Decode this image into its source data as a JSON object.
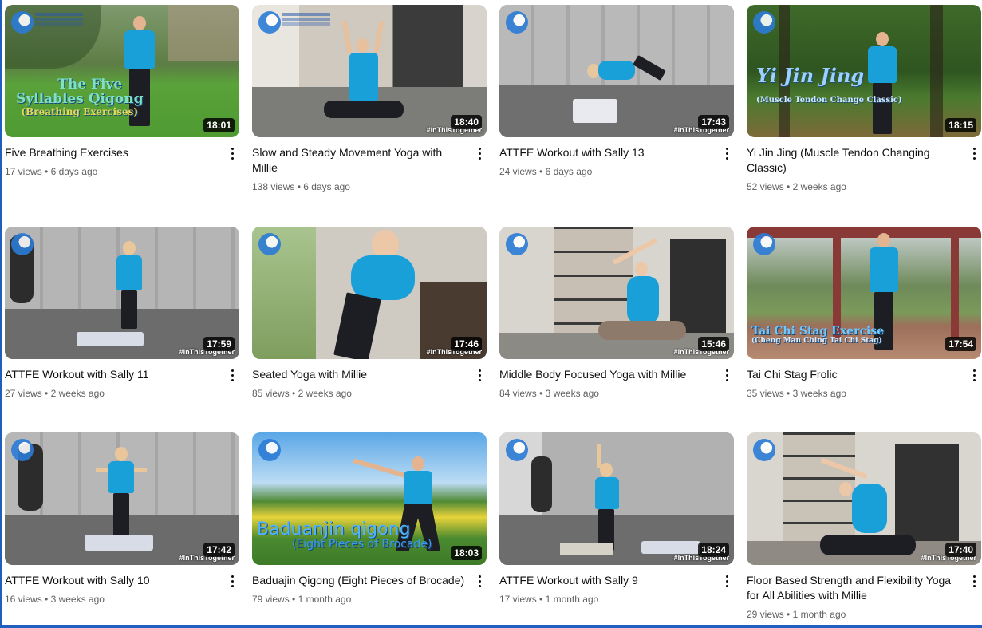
{
  "videos": [
    {
      "title": "Five Breathing Exercises",
      "views": "17 views",
      "age": "6 days ago",
      "duration": "18:01",
      "overlay_lines": [
        "The Five",
        "Syllables Qigong",
        "(Breathing Exercises)"
      ],
      "hashtag": ""
    },
    {
      "title": "Slow and Steady Movement Yoga with Millie",
      "views": "138 views",
      "age": "6 days ago",
      "duration": "18:40",
      "overlay_lines": [],
      "hashtag": "#InThisTogether"
    },
    {
      "title": "ATTFE Workout with Sally 13",
      "views": "24 views",
      "age": "6 days ago",
      "duration": "17:43",
      "overlay_lines": [],
      "hashtag": "#InThisTogether"
    },
    {
      "title": "Yi Jin Jing (Muscle Tendon Changing Classic)",
      "views": "52 views",
      "age": "2 weeks ago",
      "duration": "18:15",
      "overlay_lines": [
        "Yi Jin Jing",
        "(Muscle Tendon Change Classic)"
      ],
      "hashtag": ""
    },
    {
      "title": "ATTFE Workout with Sally 11",
      "views": "27 views",
      "age": "2 weeks ago",
      "duration": "17:59",
      "overlay_lines": [],
      "hashtag": "#InThisTogether"
    },
    {
      "title": "Seated Yoga with Millie",
      "views": "85 views",
      "age": "2 weeks ago",
      "duration": "17:46",
      "overlay_lines": [],
      "hashtag": "#InThisTogether"
    },
    {
      "title": "Middle Body Focused Yoga with Millie",
      "views": "84 views",
      "age": "3 weeks ago",
      "duration": "15:46",
      "overlay_lines": [],
      "hashtag": "#InThisTogether"
    },
    {
      "title": "Tai Chi Stag Frolic",
      "views": "35 views",
      "age": "3 weeks ago",
      "duration": "17:54",
      "overlay_lines": [
        "Tai Chi Stag Exercise",
        "(Cheng Man Ching Tai Chi Stag)"
      ],
      "hashtag": ""
    },
    {
      "title": "ATTFE Workout with Sally 10",
      "views": "16 views",
      "age": "3 weeks ago",
      "duration": "17:42",
      "overlay_lines": [],
      "hashtag": "#InThisTogether"
    },
    {
      "title": "Baduajin Qigong (Eight Pieces of Brocade)",
      "views": "79 views",
      "age": "1 month ago",
      "duration": "18:03",
      "overlay_lines": [
        "Baduanjin qigong",
        "(Eight Pieces of Brocade)"
      ],
      "hashtag": ""
    },
    {
      "title": "ATTFE Workout with Sally 9",
      "views": "17 views",
      "age": "1 month ago",
      "duration": "18:24",
      "overlay_lines": [],
      "hashtag": "#InThisTogether"
    },
    {
      "title": "Floor Based Strength and Flexibility Yoga for All Abilities with Millie",
      "views": "29 views",
      "age": "1 month ago",
      "duration": "17:40",
      "overlay_lines": [],
      "hashtag": "#InThisTogether"
    }
  ],
  "separator": "•",
  "colors": {
    "accent": "#1f5fbf",
    "shirt": "#1aa0d8",
    "overlay_text": "#5ec2ff"
  }
}
